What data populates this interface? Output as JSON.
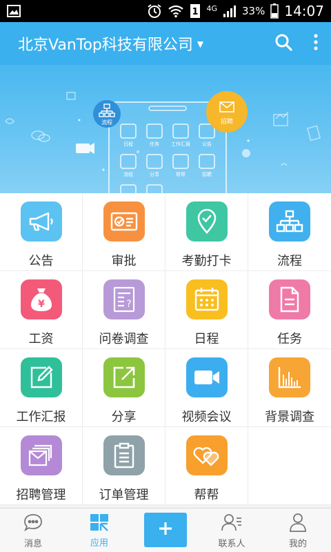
{
  "status_bar": {
    "network": "4G",
    "sim": "1",
    "battery": "33%",
    "time": "14:07"
  },
  "header": {
    "company": "北京VanTop科技有限公司",
    "icons": [
      "caret-down-icon",
      "search-icon",
      "more-vertical-icon"
    ]
  },
  "banner": {
    "flow_badge": "流程",
    "recruit_badge": "招聘",
    "tablet_items": [
      "日程",
      "任务",
      "工作汇报",
      "公告",
      "流程",
      "分享",
      "帮帮",
      "招聘"
    ]
  },
  "apps": [
    {
      "label": "公告",
      "icon": "megaphone-icon",
      "color": "#5cc2f2"
    },
    {
      "label": "审批",
      "icon": "approval-card-icon",
      "color": "#f7913f"
    },
    {
      "label": "考勤打卡",
      "icon": "location-check-icon",
      "color": "#3fc6a3"
    },
    {
      "label": "流程",
      "icon": "org-chart-icon",
      "color": "#40b0ef"
    },
    {
      "label": "工资",
      "icon": "money-bag-icon",
      "color": "#f35a7a"
    },
    {
      "label": "问卷调查",
      "icon": "questionnaire-icon",
      "color": "#b89ad8"
    },
    {
      "label": "日程",
      "icon": "calendar-icon",
      "color": "#f9be1f"
    },
    {
      "label": "任务",
      "icon": "document-icon",
      "color": "#f07aa7"
    },
    {
      "label": "工作汇报",
      "icon": "edit-icon",
      "color": "#2fc09a"
    },
    {
      "label": "分享",
      "icon": "share-icon",
      "color": "#8cc63f"
    },
    {
      "label": "视频会议",
      "icon": "video-camera-icon",
      "color": "#3caef0"
    },
    {
      "label": "背景调查",
      "icon": "bar-chart-icon",
      "color": "#f7a534"
    },
    {
      "label": "招聘管理",
      "icon": "envelope-stack-icon",
      "color": "#b48ad6"
    },
    {
      "label": "订单管理",
      "icon": "clipboard-icon",
      "color": "#8fa2a9"
    },
    {
      "label": "帮帮",
      "icon": "hearts-icon",
      "color": "#f7a02d"
    }
  ],
  "bottom_nav": {
    "items": [
      {
        "label": "消息",
        "icon": "chat-bubble-icon"
      },
      {
        "label": "应用",
        "icon": "apps-grid-icon"
      },
      {
        "label": "",
        "icon": "plus-icon"
      },
      {
        "label": "联系人",
        "icon": "contacts-icon"
      },
      {
        "label": "我的",
        "icon": "profile-icon"
      }
    ],
    "active_index": 1
  },
  "colors": {
    "accent": "#3ab0ee",
    "status_bar": "#000000",
    "grid_border": "#ececec"
  }
}
